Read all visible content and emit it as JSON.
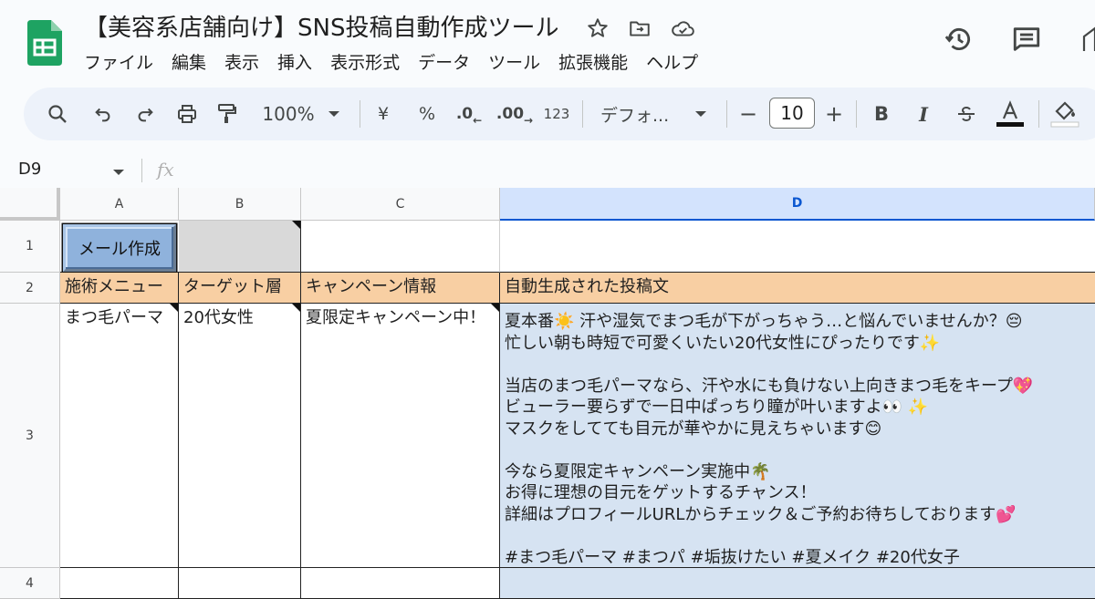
{
  "doc": {
    "title": "【美容系店舗向け】SNS投稿自動作成ツール"
  },
  "menu": [
    "ファイル",
    "編集",
    "表示",
    "挿入",
    "表示形式",
    "データ",
    "ツール",
    "拡張機能",
    "ヘルプ"
  ],
  "toolbar": {
    "zoom": "100%",
    "currency": "¥",
    "percent": "%",
    "decrease_decimal": ".0",
    "increase_decimal": ".00",
    "format_123": "123",
    "font": "デフォ...",
    "font_size": "10",
    "minus": "−",
    "plus": "+",
    "bold": "B",
    "italic": "I"
  },
  "formula_bar": {
    "name_box": "D9",
    "fx": "fx"
  },
  "grid": {
    "columns": [
      "A",
      "B",
      "C",
      "D"
    ],
    "rows": [
      "1",
      "2",
      "3",
      "4"
    ],
    "button_label": "メール作成",
    "headers": [
      "施術メニュー",
      "ターゲット層",
      "キャンペーン情報",
      "自動生成された投稿文"
    ],
    "row3": {
      "menu": "まつ毛パーマ",
      "target": "20代女性",
      "campaign": "夏限定キャンペーン中！",
      "post_lines": [
        "夏本番☀️ 汗や湿気でまつ毛が下がっちゃう…と悩んでいませんか？😔",
        "忙しい朝も時短で可愛くいたい20代女性にぴったりです✨",
        "",
        "当店のまつ毛パーマなら、汗や水にも負けない上向きまつ毛をキープ💖",
        "ビューラー要らずで一日中ぱっちり瞳が叶いますよ👀 ✨",
        "マスクをしてても目元が華やかに見えちゃいます😊",
        "",
        "今なら夏限定キャンペーン実施中🌴",
        "お得に理想の目元をゲットするチャンス！",
        "詳細はプロフィールURLからチェック＆ご予約お待ちしております💕",
        "",
        "#まつ毛パーマ #まつパ #垢抜けたい #夏メイク #20代女子"
      ]
    }
  },
  "colors": {
    "header_fill": "#f8cfa3",
    "selected_column_fill": "#d6e3f2",
    "button_fill": "#8fb2dc",
    "gray_cell": "#d9d9d9",
    "logo_green": "#1ea362"
  },
  "icons": [
    "star-icon",
    "move-to-folder-icon",
    "cloud-saved-icon",
    "history-icon",
    "comments-icon",
    "search-icon",
    "undo-icon",
    "redo-icon",
    "print-icon",
    "paint-format-icon",
    "text-color-icon",
    "fill-color-icon"
  ]
}
